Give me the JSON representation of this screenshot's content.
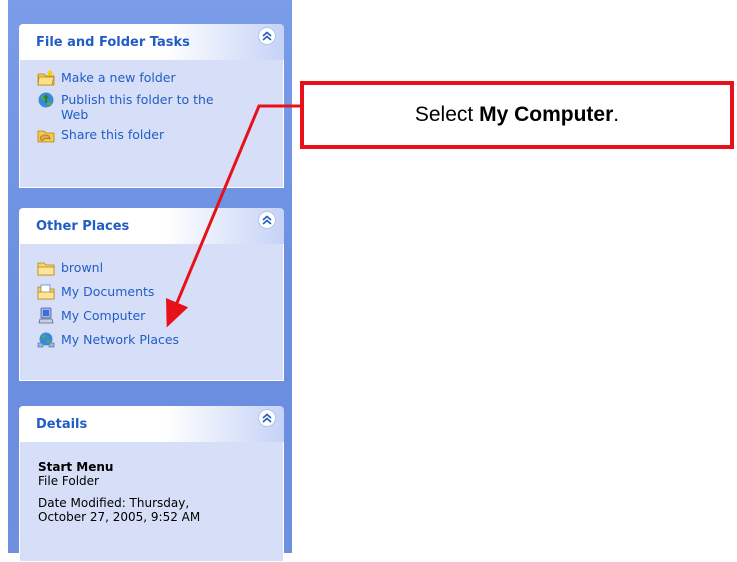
{
  "panels": {
    "file_tasks": {
      "title": "File and Folder Tasks",
      "items": [
        {
          "label": "Make a new folder",
          "icon": "new-folder-icon"
        },
        {
          "label": "Publish this folder to the",
          "label2": "Web",
          "icon": "publish-web-icon"
        },
        {
          "label": "Share this folder",
          "icon": "share-folder-icon"
        }
      ]
    },
    "other_places": {
      "title": "Other Places",
      "items": [
        {
          "label": "brownl",
          "icon": "folder-icon"
        },
        {
          "label": "My Documents",
          "icon": "my-documents-icon"
        },
        {
          "label": "My Computer",
          "icon": "my-computer-icon"
        },
        {
          "label": "My Network Places",
          "icon": "network-places-icon"
        }
      ]
    },
    "details": {
      "title": "Details",
      "name": "Start Menu",
      "type": "File Folder",
      "modified_line1": "Date Modified: Thursday,",
      "modified_line2": "October 27, 2005, 9:52 AM"
    }
  },
  "callout": {
    "prefix": "Select ",
    "emphasis": "My Computer",
    "suffix": "."
  },
  "colors": {
    "link": "#215dc6",
    "callout_border": "#e8111a",
    "arrow": "#e8111a"
  }
}
